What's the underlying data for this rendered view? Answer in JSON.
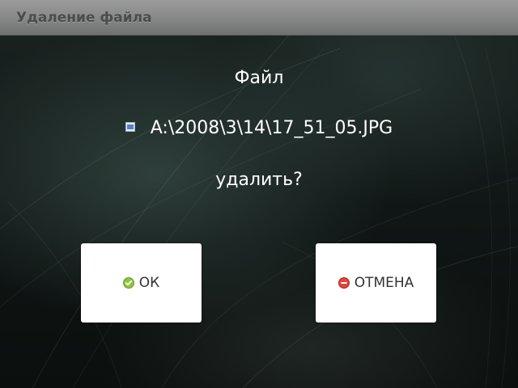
{
  "dialog": {
    "title": "Удаление файла",
    "line1": "Файл",
    "file": {
      "icon": "image-file-icon",
      "path": "A:\\2008\\3\\14\\17_51_05.JPG"
    },
    "line3": "удалить?"
  },
  "buttons": {
    "ok": {
      "label": "ОК",
      "icon": "check-circle-icon",
      "icon_color": "#8dc63f"
    },
    "cancel": {
      "label": "ОТМЕНА",
      "icon": "minus-circle-icon",
      "icon_color": "#e0443a"
    }
  }
}
